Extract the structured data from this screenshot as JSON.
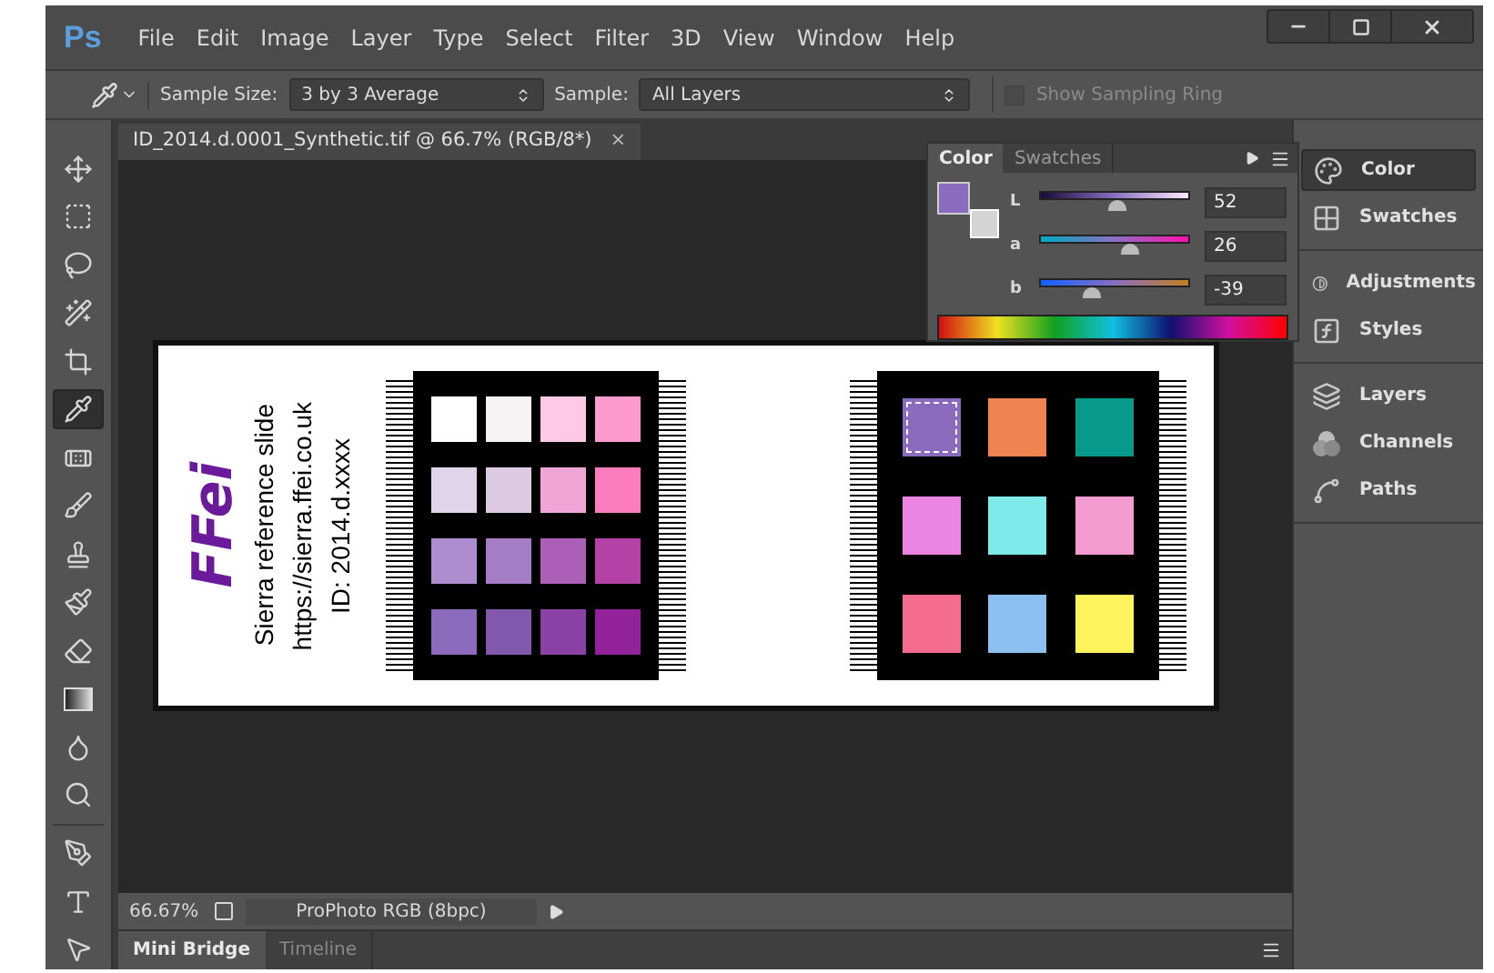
{
  "app_logo": "Ps",
  "menu": [
    "File",
    "Edit",
    "Image",
    "Layer",
    "Type",
    "Select",
    "Filter",
    "3D",
    "View",
    "Window",
    "Help"
  ],
  "options_bar": {
    "sample_size_label": "Sample Size:",
    "sample_size": "3 by 3 Average",
    "sample_label": "Sample:",
    "sample": "All Layers",
    "sampling_ring": {
      "label": "Show Sampling Ring",
      "checked": false
    }
  },
  "tools": [
    {
      "kind": "move",
      "selected": false
    },
    {
      "kind": "marquee",
      "selected": false
    },
    {
      "kind": "lasso",
      "selected": false
    },
    {
      "kind": "quickselect",
      "selected": false
    },
    {
      "kind": "crop",
      "selected": false
    },
    {
      "kind": "eyedropper",
      "selected": true
    },
    {
      "kind": "healing",
      "selected": false
    },
    {
      "kind": "brush",
      "selected": false
    },
    {
      "kind": "stamp",
      "selected": false
    },
    {
      "kind": "historybrush",
      "selected": false
    },
    {
      "kind": "eraser",
      "selected": false
    },
    {
      "kind": "gradient",
      "selected": false
    },
    {
      "kind": "blur",
      "selected": false
    },
    {
      "kind": "dodge",
      "selected": false
    },
    {
      "kind": "pen",
      "selected": false
    },
    {
      "kind": "type",
      "selected": false
    },
    {
      "kind": "pathselect",
      "selected": false
    }
  ],
  "document": {
    "tab": "ID_2014.d.0001_Synthetic.tif @ 66.7% (RGB/8*)",
    "close": "×",
    "slide": {
      "logo": "FFei",
      "lines": [
        "Sierra reference slide",
        "https://sierra.ffei.co.uk",
        "ID:  2014.d.xxxx"
      ],
      "grids": [
        {
          "swatches": [
            {
              "color": "#ffffff"
            },
            {
              "color": "#f7f2f4"
            },
            {
              "color": "#fdc9e6"
            },
            {
              "color": "#fd9ad0"
            },
            {
              "color": "#e0d4ea"
            },
            {
              "color": "#dccbe2"
            },
            {
              "color": "#efa6d6"
            },
            {
              "color": "#fb7dbd"
            },
            {
              "color": "#ae8cd0"
            },
            {
              "color": "#a57cc6"
            },
            {
              "color": "#ab5fb7"
            },
            {
              "color": "#b442a6"
            },
            {
              "color": "#8c6bbd"
            },
            {
              "color": "#8258ad"
            },
            {
              "color": "#8a41a6"
            },
            {
              "color": "#91229a"
            }
          ]
        },
        {
          "swatches": [
            {
              "color": "#8b6bbd",
              "selected": true
            },
            {
              "color": "#f08450",
              "selected": false
            },
            {
              "color": "#079a8a",
              "selected": false
            },
            {
              "color": "#ec84e3",
              "selected": false
            },
            {
              "color": "#7eeaea",
              "selected": false
            },
            {
              "color": "#f39ad0",
              "selected": false
            },
            {
              "color": "#f56d8e",
              "selected": false
            },
            {
              "color": "#8cc0f0",
              "selected": false
            },
            {
              "color": "#fdf35c",
              "selected": false
            }
          ]
        }
      ]
    }
  },
  "status_bar": {
    "zoom": "66.67%",
    "profile": "ProPhoto RGB (8bpc)"
  },
  "bottom_tabs": [
    {
      "label": "Mini Bridge",
      "selected": true
    },
    {
      "label": "Timeline",
      "selected": false
    }
  ],
  "color_panel": {
    "tabs": [
      {
        "label": "Color",
        "selected": true
      },
      {
        "label": "Swatches",
        "selected": false
      }
    ],
    "color_boxes": [
      {
        "kind": "foreground",
        "color": "#8b6bbd"
      },
      {
        "kind": "background",
        "color": "#d4d4d4"
      }
    ],
    "channels": [
      {
        "label": "L",
        "level": 0.52,
        "value": "52"
      },
      {
        "label": "a",
        "level": 0.6,
        "value": "26"
      },
      {
        "label": "b",
        "level": 0.35,
        "value": "-39"
      }
    ]
  },
  "panels": [
    [
      {
        "kind": "color",
        "label": "Color",
        "selected": true
      },
      {
        "kind": "swatches",
        "label": "Swatches",
        "selected": false
      }
    ],
    [
      {
        "kind": "adjustments",
        "label": "Adjustments",
        "selected": false
      },
      {
        "kind": "styles",
        "label": "Styles",
        "selected": false
      }
    ],
    [
      {
        "kind": "layers",
        "label": "Layers",
        "selected": false
      },
      {
        "kind": "channels",
        "label": "Channels",
        "selected": false
      },
      {
        "kind": "paths",
        "label": "Paths",
        "selected": false
      }
    ]
  ]
}
